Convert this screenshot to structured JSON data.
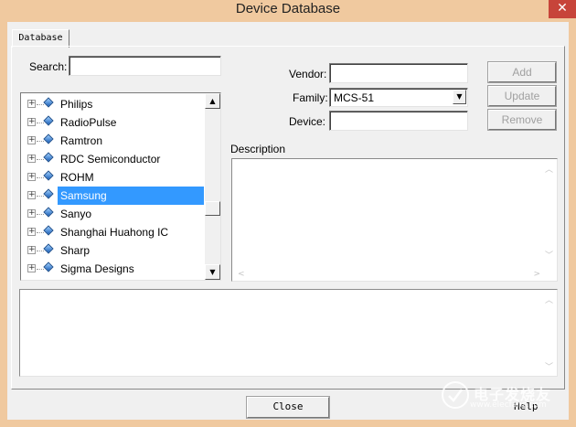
{
  "window": {
    "title": "Device Database",
    "close_glyph": "✕"
  },
  "tab": {
    "label": "Database"
  },
  "search": {
    "label": "Search:",
    "value": ""
  },
  "vendor": {
    "label": "Vendor:",
    "value": ""
  },
  "family": {
    "label": "Family:",
    "value": "MCS-51"
  },
  "device": {
    "label": "Device:",
    "value": ""
  },
  "buttons": {
    "add": "Add",
    "update": "Update",
    "remove": "Remove",
    "close": "Close",
    "help": "Help"
  },
  "description": {
    "label": "Description",
    "text": ""
  },
  "tree": {
    "items": [
      {
        "label": "Philips",
        "selected": false
      },
      {
        "label": "RadioPulse",
        "selected": false
      },
      {
        "label": "Ramtron",
        "selected": false
      },
      {
        "label": "RDC Semiconductor",
        "selected": false
      },
      {
        "label": "ROHM",
        "selected": false
      },
      {
        "label": "Samsung",
        "selected": true
      },
      {
        "label": "Sanyo",
        "selected": false
      },
      {
        "label": "Shanghai Huahong IC",
        "selected": false
      },
      {
        "label": "Sharp",
        "selected": false
      },
      {
        "label": "Sigma Designs",
        "selected": false
      }
    ]
  },
  "watermark": {
    "text_cn": "电子发烧友",
    "url": "www.elecfans.com"
  },
  "icons": [
    "close-icon",
    "expand-plus-icon",
    "device-diamond-icon",
    "scroll-up-icon",
    "scroll-down-icon",
    "dropdown-arrow-icon",
    "scroll-left-icon",
    "scroll-right-icon"
  ],
  "colors": {
    "title_bar": "#f0c99f",
    "selection": "#3399ff",
    "window_bg": "#f0f0f0",
    "close_button": "#c7443a"
  }
}
